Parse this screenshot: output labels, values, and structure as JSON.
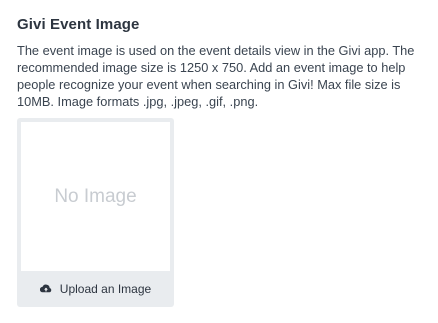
{
  "section": {
    "title": "Givi Event Image",
    "description": "The event image is used on the event details view in the Givi app. The recommended image size is 1250 x 750. Add an event image to help people recognize your event when searching in Givi! Max file size is 10MB. Image formats .jpg, .jpeg, .gif, .png."
  },
  "image_card": {
    "placeholder": "No Image",
    "upload_label": "Upload an Image",
    "upload_icon": "cloud-upload-icon"
  }
}
